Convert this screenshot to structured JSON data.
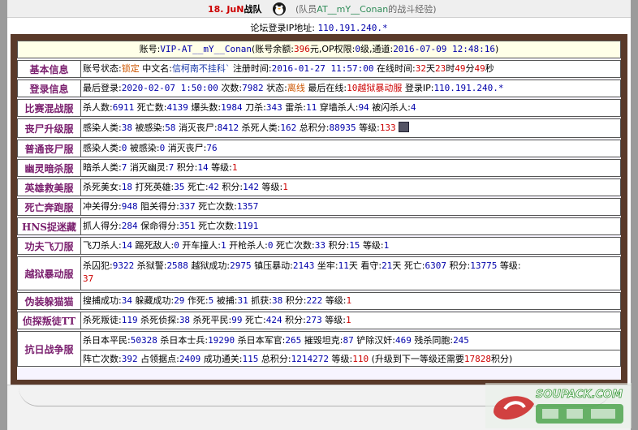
{
  "header": {
    "team_number": "18.",
    "team_tag": "JuN",
    "team_suffix": "战队",
    "tagline_prefix": "(队员",
    "tagline_name": "AT__mY__Conan",
    "tagline_suffix": "的战斗经验)"
  },
  "ip_line": {
    "label": "论坛登录IP地址:",
    "value": "110.191.240.*"
  },
  "account": {
    "account_label": "账号:",
    "account_name": "VIP-AT__mY__Conan",
    "balance_label": "(账号余额:",
    "balance": "396",
    "balance_unit": "元,",
    "op_label": "OP权限:",
    "op_value": "0",
    "op_unit": "级,",
    "channel_label": "通道:",
    "channel_value": "2016-07-09 12:48:16",
    "close": ")"
  },
  "sections": {
    "basic": {
      "label": "基本信息",
      "status_label": "账号状态:",
      "status": "锁定",
      "cname_label": "中文名:",
      "cname": "信柯南不挂科`",
      "reg_label": "注册时间:",
      "reg": "2016-01-27 11:57:00",
      "online_label": "在线时间:",
      "days": "32",
      "d": "天",
      "hours": "23",
      "h": "时",
      "mins": "49",
      "m": "分",
      "secs": "49",
      "s": "秒"
    },
    "login": {
      "label": "登录信息",
      "last_label": "最后登录:",
      "last": "2020-02-07 1:50:00",
      "count_label": "次数:",
      "count": "7982",
      "state_label": "状态:",
      "state": "离线",
      "lastsrv_label": "最后在线:",
      "lastsrv": "10越狱暴动服",
      "ip_label": "登录IP:",
      "ip": "110.191.240.*"
    },
    "mix": {
      "label": "比赛混战服",
      "kills_l": "杀人数:",
      "kills": "6911",
      "deaths_l": "死亡数:",
      "deaths": "4139",
      "hs_l": "爆头数:",
      "hs": "1984",
      "knife_l": "刀杀:",
      "knife": "343",
      "nade_l": "雷杀:",
      "nade": "11",
      "wall_l": "穿墙杀人:",
      "wall": "94",
      "flash_l": "被闪杀人:",
      "flash": "4"
    },
    "zombie_up": {
      "label": "丧尸升级服",
      "inf_l": "感染人类:",
      "inf": "38",
      "infd_l": "被感染:",
      "infd": "58",
      "elim_l": "消灭丧尸:",
      "elim": "8412",
      "kh_l": "杀死人类:",
      "kh": "162",
      "score_l": "总积分:",
      "score": "88935",
      "lvl_l": "等级:",
      "lvl": "133"
    },
    "zombie_normal": {
      "label": "普通丧尸服",
      "inf_l": "感染人类:",
      "inf": "0",
      "infd_l": "被感染:",
      "infd": "0",
      "elim_l": "消灭丧尸:",
      "elim": "76"
    },
    "ghost": {
      "label": "幽灵暗杀服",
      "a_l": "暗杀人类:",
      "a": "7",
      "e_l": "消灭幽灵:",
      "e": "7",
      "p_l": "积分:",
      "p": "14",
      "lv_l": "等级:",
      "lv": "1"
    },
    "hero": {
      "label": "英雄救美服",
      "k_l": "杀死美女:",
      "k": "18",
      "h_l": "打死英雄:",
      "h": "35",
      "d_l": "死亡:",
      "d": "42",
      "p_l": "积分:",
      "p": "142",
      "lv_l": "等级:",
      "lv": "1"
    },
    "deathrun": {
      "label": "死亡奔跑服",
      "c_l": "冲关得分:",
      "c": "948",
      "b_l": "阻关得分:",
      "b": "337",
      "d_l": "死亡次数:",
      "d": "1357"
    },
    "hns": {
      "label": "HNS捉迷藏",
      "c_l": "抓人得分:",
      "c": "284",
      "s_l": "保命得分:",
      "s": "351",
      "d_l": "死亡次数:",
      "d": "1191"
    },
    "kungfu": {
      "label": "功夫飞刀服",
      "f_l": "飞刀杀人:",
      "f": "14",
      "k_l": "踢死敌人:",
      "k": "0",
      "c_l": "开车撞人:",
      "c": "1",
      "g_l": "开枪杀人:",
      "g": "0",
      "d_l": "死亡次数:",
      "d": "33",
      "p_l": "积分:",
      "p": "15",
      "lv_l": "等级:",
      "lv": "1"
    },
    "jail": {
      "label": "越狱暴动服",
      "p_l": "杀囚犯:",
      "p": "9322",
      "g_l": "杀狱警:",
      "g": "2588",
      "e_l": "越狱成功:",
      "e": "2975",
      "r_l": "镇压暴动:",
      "r": "2143",
      "j_l": "坐牢:",
      "j": "11",
      "j_u": "天",
      "w_l": "看守:",
      "w": "21",
      "w_u": "天",
      "d_l": "死亡:",
      "d": "6307",
      "s_l": "积分:",
      "s": "13775",
      "lv_l": "等级:",
      "lv": "37"
    },
    "hide": {
      "label": "伪装躲猫猫",
      "c_l": "搜捕成功:",
      "c": "34",
      "h_l": "躲藏成功:",
      "h": "29",
      "x_l": "作死:",
      "x": "5",
      "b_l": "被捕:",
      "b": "31",
      "g_l": "抓获:",
      "g": "38",
      "p_l": "积分:",
      "p": "222",
      "lv_l": "等级:",
      "lv": "1"
    },
    "detective": {
      "label": "侦探叛徒TT",
      "t_l": "杀死叛徒:",
      "t": "119",
      "d_l": "杀死侦探:",
      "d": "38",
      "c_l": "杀死平民:",
      "c": "99",
      "x_l": "死亡:",
      "x": "424",
      "p_l": "积分:",
      "p": "273",
      "lv_l": "等级:",
      "lv": "1"
    },
    "antijp": {
      "label": "抗日战争服",
      "a_l": "杀日本平民:",
      "a": "50328",
      "b_l": "杀日本士兵:",
      "b": "19290",
      "c_l": "杀日本军官:",
      "c": "265",
      "d_l": "摧毁坦克:",
      "d": "87",
      "e_l": "铲除汉奸:",
      "e": "469",
      "f_l": "残杀同胞:",
      "f": "245",
      "g_l": "阵亡次数:",
      "g": "392",
      "h_l": "占领据点:",
      "h": "2409",
      "i_l": "成功通关:",
      "i": "115",
      "j_l": "总积分:",
      "j": "1214272",
      "k_l": "等级:",
      "k": "110",
      "next_pre": "(升级到下一等级还需要",
      "next": "17828",
      "next_post": "积分)"
    }
  },
  "watermark": {
    "line1": "SOUPACK.COM",
    "colors": {
      "red": "#cc2222",
      "green": "#3a9a3a"
    }
  }
}
